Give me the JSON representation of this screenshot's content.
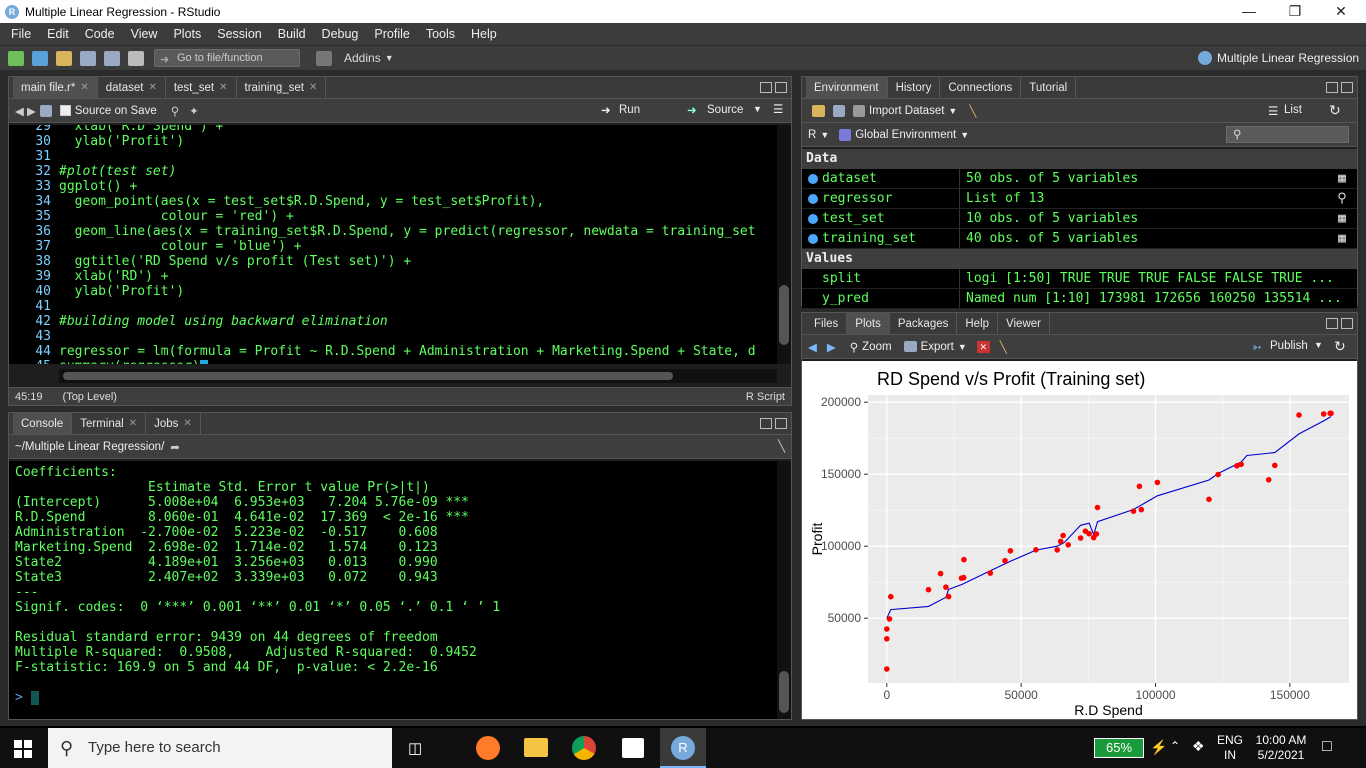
{
  "window": {
    "title": "Multiple Linear Regression - RStudio"
  },
  "menu": [
    "File",
    "Edit",
    "Code",
    "View",
    "Plots",
    "Session",
    "Build",
    "Debug",
    "Profile",
    "Tools",
    "Help"
  ],
  "toolbar": {
    "goto_placeholder": "Go to file/function",
    "addins": "Addins",
    "project": "Multiple Linear Regression"
  },
  "editor": {
    "tabs": [
      {
        "label": "main file.r*",
        "active": true
      },
      {
        "label": "dataset",
        "active": false
      },
      {
        "label": "test_set",
        "active": false
      },
      {
        "label": "training_set",
        "active": false
      }
    ],
    "source_on_save": "Source on Save",
    "run": "Run",
    "source": "Source",
    "lines": [
      {
        "n": "29",
        "text": "  xlab('R.D Spend') +"
      },
      {
        "n": "30",
        "text": "  ylab('Profit')"
      },
      {
        "n": "31",
        "text": ""
      },
      {
        "n": "32",
        "text": "#plot(test set)",
        "comment": true
      },
      {
        "n": "33",
        "text": "ggplot() +"
      },
      {
        "n": "34",
        "text": "  geom_point(aes(x = test_set$R.D.Spend, y = test_set$Profit),"
      },
      {
        "n": "35",
        "text": "             colour = 'red') +"
      },
      {
        "n": "36",
        "text": "  geom_line(aes(x = training_set$R.D.Spend, y = predict(regressor, newdata = training_set"
      },
      {
        "n": "37",
        "text": "             colour = 'blue') +"
      },
      {
        "n": "38",
        "text": "  ggtitle('RD Spend v/s profit (Test set)') +"
      },
      {
        "n": "39",
        "text": "  xlab('RD') +"
      },
      {
        "n": "40",
        "text": "  ylab('Profit')"
      },
      {
        "n": "41",
        "text": ""
      },
      {
        "n": "42",
        "text": "#building model using backward elimination",
        "comment": true
      },
      {
        "n": "43",
        "text": ""
      },
      {
        "n": "44",
        "text": "regressor = lm(formula = Profit ~ R.D.Spend + Administration + Marketing.Spend + State, d"
      },
      {
        "n": "45",
        "text": "summary(regressor)"
      }
    ],
    "position": "45:19",
    "scope": "(Top Level)",
    "filetype": "R Script"
  },
  "console": {
    "tabs": [
      "Console",
      "Terminal",
      "Jobs"
    ],
    "path": "~/Multiple Linear Regression/",
    "lines": [
      "Coefficients:",
      "                 Estimate Std. Error t value Pr(>|t|)    ",
      "(Intercept)      5.008e+04  6.953e+03   7.204 5.76e-09 ***",
      "R.D.Spend        8.060e-01  4.641e-02  17.369  < 2e-16 ***",
      "Administration  -2.700e-02  5.223e-02  -0.517    0.608    ",
      "Marketing.Spend  2.698e-02  1.714e-02   1.574    0.123    ",
      "State2           4.189e+01  3.256e+03   0.013    0.990    ",
      "State3           2.407e+02  3.339e+03   0.072    0.943    ",
      "---",
      "Signif. codes:  0 ‘***’ 0.001 ‘**’ 0.01 ‘*’ 0.05 ‘.’ 0.1 ‘ ’ 1",
      "",
      "Residual standard error: 9439 on 44 degrees of freedom",
      "Multiple R-squared:  0.9508,\tAdjusted R-squared:  0.9452 ",
      "F-statistic: 169.9 on 5 and 44 DF,  p-value: < 2.2e-16",
      ""
    ],
    "prompt": ">"
  },
  "environment": {
    "tabs": [
      "Environment",
      "History",
      "Connections",
      "Tutorial"
    ],
    "import_dataset": "Import Dataset",
    "list_mode": "List",
    "lang": "R",
    "scope": "Global Environment",
    "data_header": "Data",
    "data": [
      {
        "name": "dataset",
        "value": "50 obs. of 5 variables"
      },
      {
        "name": "regressor",
        "value": "List of  13"
      },
      {
        "name": "test_set",
        "value": "10 obs. of 5 variables"
      },
      {
        "name": "training_set",
        "value": "40 obs. of 5 variables"
      }
    ],
    "values_header": "Values",
    "values": [
      {
        "name": "split",
        "value": "logi [1:50] TRUE TRUE TRUE FALSE FALSE TRUE ..."
      },
      {
        "name": "y_pred",
        "value": "Named num [1:10] 173981 172656 160250 135514 ..."
      }
    ]
  },
  "files": {
    "tabs": [
      "Files",
      "Plots",
      "Packages",
      "Help",
      "Viewer"
    ],
    "zoom": "Zoom",
    "export": "Export",
    "publish": "Publish"
  },
  "chart_data": {
    "type": "scatter",
    "title": "RD Spend v/s Profit (Training set)",
    "xlabel": "R.D Spend",
    "ylabel": "Profit",
    "xlim": [
      -7000,
      172000
    ],
    "ylim": [
      5000,
      205000
    ],
    "xticks": [
      0,
      50000,
      100000,
      150000
    ],
    "yticks": [
      50000,
      100000,
      150000,
      200000
    ],
    "xtick_labels": [
      "0",
      "50000",
      "100000",
      "150000"
    ],
    "ytick_labels": [
      "50000",
      "100000",
      "150000",
      "200000"
    ],
    "grid": true,
    "colors": {
      "points": "#ff0000",
      "line": "#0000cc",
      "panel": "#ebebeb"
    },
    "series": [
      {
        "kind": "points",
        "x": [
          0,
          0,
          0,
          1000,
          1500,
          15500,
          20000,
          23000,
          22000,
          27800,
          28600,
          28700,
          38500,
          44000,
          46000,
          55500,
          63400,
          64700,
          65600,
          67500,
          72100,
          73900,
          75300,
          77000,
          78000,
          78400,
          91800,
          94000,
          94700,
          100700,
          119900,
          123300,
          130300,
          131900,
          142100,
          144400,
          153400,
          162600,
          165300,
          165000
        ],
        "y": [
          14700,
          42500,
          35700,
          49500,
          64900,
          69800,
          81000,
          65000,
          71500,
          77800,
          78200,
          90700,
          81300,
          89900,
          96800,
          97500,
          97400,
          103300,
          107400,
          101000,
          105700,
          110400,
          108700,
          106000,
          108500,
          126900,
          124300,
          141600,
          125400,
          144300,
          132600,
          149800,
          155800,
          156900,
          146100,
          156100,
          191100,
          191800,
          192300,
          192300
        ]
      },
      {
        "kind": "line",
        "x": [
          0,
          1500,
          15500,
          22000,
          23000,
          28000,
          38500,
          46000,
          55500,
          63400,
          66000,
          72100,
          75300,
          77000,
          78400,
          91800,
          100700,
          119900,
          123300,
          131900,
          134000,
          144400,
          153400,
          162600,
          165300
        ],
        "y": [
          50000,
          56000,
          58200,
          64500,
          70000,
          73500,
          83000,
          89500,
          97300,
          100000,
          102500,
          114500,
          116000,
          108000,
          117000,
          125500,
          135000,
          146000,
          150500,
          158500,
          163000,
          165000,
          178000,
          187000,
          190000
        ]
      }
    ]
  }
}
